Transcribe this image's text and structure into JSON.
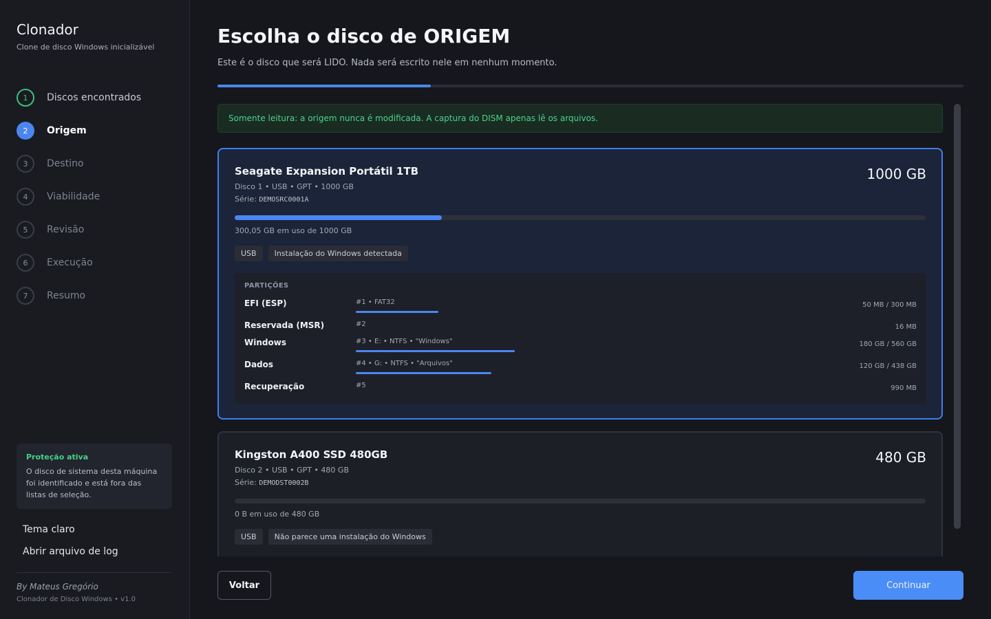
{
  "sidebar": {
    "app_title": "Clonador",
    "app_subtitle": "Clone de disco Windows inicializável",
    "steps": [
      {
        "num": "1",
        "label": "Discos encontrados",
        "state": "done"
      },
      {
        "num": "2",
        "label": "Origem",
        "state": "active"
      },
      {
        "num": "3",
        "label": "Destino",
        "state": "pending"
      },
      {
        "num": "4",
        "label": "Viabilidade",
        "state": "pending"
      },
      {
        "num": "5",
        "label": "Revisão",
        "state": "pending"
      },
      {
        "num": "6",
        "label": "Execução",
        "state": "pending"
      },
      {
        "num": "7",
        "label": "Resumo",
        "state": "pending"
      }
    ],
    "protection": {
      "title": "Proteção ativa",
      "text": "O disco de sistema desta máquina foi identificado e está fora das listas de seleção."
    },
    "theme_link": "Tema claro",
    "log_link": "Abrir arquivo de log",
    "author": "By Mateus Gregório",
    "version": "Clonador de Disco Windows • v1.0"
  },
  "main": {
    "title": "Escolha o disco de ORIGEM",
    "subtitle": "Este é o disco que será LIDO. Nada será escrito nele em nenhum momento.",
    "progress": 0.286,
    "notice": "Somente leitura: a origem nunca é modificada. A captura do DISM apenas lê os arquivos.",
    "disks": [
      {
        "name": "Seagate Expansion Portátil 1TB",
        "size": "1000 GB",
        "meta": "Disco 1 • USB • GPT • 1000 GB",
        "serial_label": "Série: ",
        "serial": "DEMOSRC0001A",
        "usage_fraction": 0.3,
        "usage_text": "300,05 GB em uso de 1000 GB",
        "tags": [
          "USB",
          "Instalação do Windows detectada"
        ],
        "selected": true,
        "partitions_title": "PARTIÇÕES",
        "partitions": [
          {
            "name": "EFI (ESP)",
            "info": "#1 • FAT32",
            "amount": "50 MB / 300 MB",
            "usage": 0.167
          },
          {
            "name": "Reservada (MSR)",
            "info": "#2",
            "amount": "16 MB",
            "usage": null
          },
          {
            "name": "Windows",
            "info": "#3 • E: • NTFS • \"Windows\"",
            "amount": "180 GB / 560 GB",
            "usage": 0.321
          },
          {
            "name": "Dados",
            "info": "#4 • G: • NTFS • \"Arquivos\"",
            "amount": "120 GB / 438 GB",
            "usage": 0.274
          },
          {
            "name": "Recuperação",
            "info": "#5",
            "amount": "990 MB",
            "usage": null
          }
        ]
      },
      {
        "name": "Kingston A400 SSD 480GB",
        "size": "480 GB",
        "meta": "Disco 2 • USB • GPT • 480 GB",
        "serial_label": "Série: ",
        "serial": "DEMODST0002B",
        "usage_fraction": 0,
        "usage_text": "0 B em uso de 480 GB",
        "tags": [
          "USB",
          "Não parece uma instalação do Windows"
        ],
        "selected": false
      }
    ],
    "back_label": "Voltar",
    "continue_label": "Continuar"
  }
}
